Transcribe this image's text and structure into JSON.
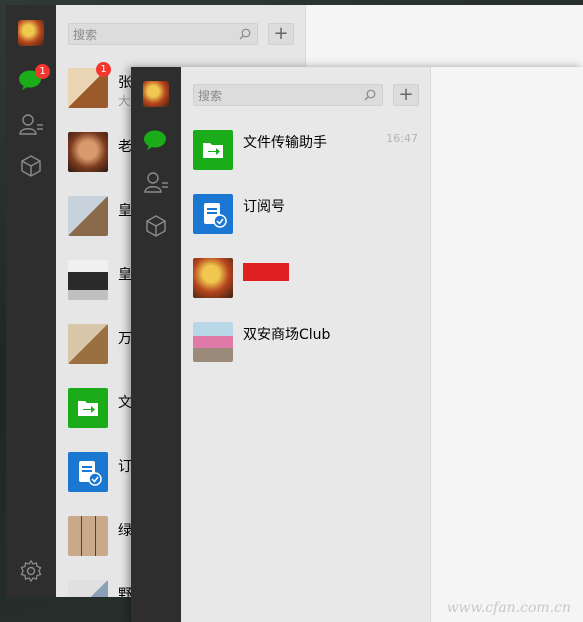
{
  "back_window": {
    "search": {
      "placeholder": "搜索"
    },
    "add_label": "+",
    "chat_badge": "1",
    "conversations": [
      {
        "name": "张",
        "preview": "大",
        "badge": "1"
      },
      {
        "name": "老",
        "preview": ""
      },
      {
        "name": "皇",
        "preview": ""
      },
      {
        "name": "皇",
        "preview": ""
      },
      {
        "name": "万",
        "preview": ""
      },
      {
        "name": "文",
        "preview": ""
      },
      {
        "name": "订",
        "preview": ""
      },
      {
        "name": "绿",
        "preview": ""
      },
      {
        "name": "野",
        "preview": ""
      }
    ]
  },
  "front_window": {
    "search": {
      "placeholder": "搜索"
    },
    "add_label": "+",
    "conversations": [
      {
        "name": "文件传输助手",
        "time": "16:47"
      },
      {
        "name": "订阅号",
        "time": ""
      },
      {
        "name": "",
        "time": ""
      },
      {
        "name": "双安商场Club",
        "time": ""
      }
    ]
  },
  "watermark": "www.cfan.com.cn",
  "colors": {
    "accent_green": "#1aad19",
    "sidebar": "#2e2e2e",
    "badge_red": "#f43530",
    "blue_tile": "#1a77d2"
  }
}
